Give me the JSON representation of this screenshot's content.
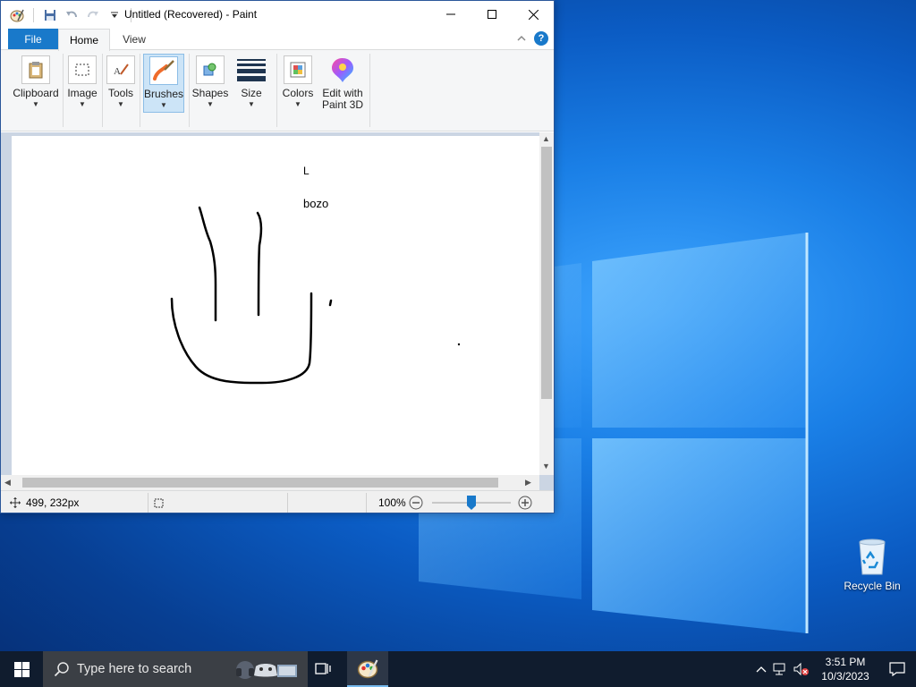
{
  "window": {
    "title": "Untitled (Recovered) - Paint"
  },
  "tabs": {
    "file": "File",
    "home": "Home",
    "view": "View"
  },
  "ribbon": {
    "clipboard": "Clipboard",
    "image": "Image",
    "tools": "Tools",
    "brushes": "Brushes",
    "shapes": "Shapes",
    "size": "Size",
    "colors": "Colors",
    "edit3d_line1": "Edit with",
    "edit3d_line2": "Paint 3D"
  },
  "canvas": {
    "text_l": "L",
    "text_bozo": "bozo"
  },
  "status": {
    "position": "499, 232px",
    "zoom": "100%",
    "zoom_level": 0.5
  },
  "desktop": {
    "recycle_bin": "Recycle Bin"
  },
  "taskbar": {
    "search_placeholder": "Type here to search",
    "time": "3:51 PM",
    "date": "10/3/2023"
  },
  "colors": {
    "accent": "#1979ca",
    "ribbon_bg": "#f5f6f7",
    "taskbar": "#101c2e"
  }
}
